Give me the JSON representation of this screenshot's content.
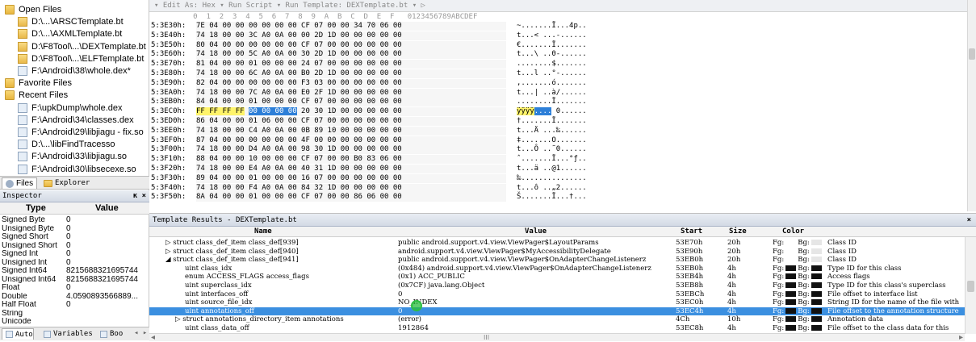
{
  "file_tree": {
    "items": [
      {
        "label": "Open Files",
        "icon": "folder-icon",
        "kind": "folder",
        "level": 0
      },
      {
        "label": "D:\\...\\ARSCTemplate.bt",
        "icon": "template-file-icon",
        "kind": "dex",
        "level": 1
      },
      {
        "label": "D:\\...\\AXMLTemplate.bt",
        "icon": "template-file-icon",
        "kind": "dex",
        "level": 1
      },
      {
        "label": "D:\\F8Tool\\...\\DEXTemplate.bt",
        "icon": "template-file-icon",
        "kind": "dex",
        "level": 1
      },
      {
        "label": "D:\\F8Tool\\...\\ELFTemplate.bt",
        "icon": "template-file-icon",
        "kind": "dex",
        "level": 1
      },
      {
        "label": "F:\\Android\\38\\whole.dex*",
        "icon": "document-icon",
        "kind": "doc",
        "level": 1
      },
      {
        "label": "Favorite Files",
        "icon": "folder-icon",
        "kind": "folder",
        "level": 0
      },
      {
        "label": "Recent Files",
        "icon": "folder-icon",
        "kind": "folder",
        "level": 0
      },
      {
        "label": "F:\\upkDump\\whole.dex",
        "icon": "document-icon",
        "kind": "doc",
        "level": 1
      },
      {
        "label": "F:\\Android\\34\\classes.dex",
        "icon": "document-icon",
        "kind": "doc",
        "level": 1
      },
      {
        "label": "F:\\Android\\29\\libjiagu - fix.so",
        "icon": "document-icon",
        "kind": "doc",
        "level": 1
      },
      {
        "label": "D:\\...\\libFindTracesso",
        "icon": "document-icon",
        "kind": "doc",
        "level": 1
      },
      {
        "label": "F:\\Android\\33\\libjiagu.so",
        "icon": "document-icon",
        "kind": "doc",
        "level": 1
      },
      {
        "label": "F:\\Android\\30\\libsecexe.so",
        "icon": "document-icon",
        "kind": "doc",
        "level": 1
      }
    ],
    "tabs": [
      {
        "label": "Files"
      },
      {
        "label": "Explorer"
      }
    ]
  },
  "inspector": {
    "title": "Inspector",
    "pin": "ĸ ×",
    "col_type": "Type",
    "col_value": "Value",
    "rows": [
      {
        "type": "Signed Byte",
        "value": "0"
      },
      {
        "type": "Unsigned Byte",
        "value": "0"
      },
      {
        "type": "Signed Short",
        "value": "0"
      },
      {
        "type": "Unsigned Short",
        "value": "0"
      },
      {
        "type": "Signed Int",
        "value": "0"
      },
      {
        "type": "Unsigned Int",
        "value": "0"
      },
      {
        "type": "Signed Int64",
        "value": "8215688321695744"
      },
      {
        "type": "Unsigned Int64",
        "value": "8215688321695744"
      },
      {
        "type": "Float",
        "value": "0"
      },
      {
        "type": "Double",
        "value": "4.0590893566889..."
      },
      {
        "type": "Half Float",
        "value": "0"
      },
      {
        "type": "String",
        "value": ""
      },
      {
        "type": "Unicode",
        "value": ""
      }
    ],
    "tabs": [
      {
        "label": "Auto"
      },
      {
        "label": "Variables"
      },
      {
        "label": "Boo"
      }
    ]
  },
  "hex_editor": {
    "toolbar": "▾  Edit As: Hex ▾   Run Script ▾   Run Template: DEXTemplate.bt ▾  ▷",
    "column_header": "          0  1  2  3  4  5  6  7  8  9  A  B  C  D  E  F   0123456789ABCDEF",
    "rows": [
      {
        "addr": "5:3E30h:",
        "bytes": "7E 04 00 00 00 00 00 00 CF 07 00 00 34 70 06 00",
        "ascii": "~.......Ï...4p.."
      },
      {
        "addr": "5:3E40h:",
        "bytes": "74 18 00 00 3C A0 0A 00 00 2D 1D 00 00 00 00 00",
        "ascii": "t...< ...-......"
      },
      {
        "addr": "5:3E50h:",
        "bytes": "80 04 00 00 00 00 00 00 CF 07 00 00 00 00 00 00",
        "ascii": "€.......Ï......."
      },
      {
        "addr": "5:3E60h:",
        "bytes": "74 18 00 00 5C A0 0A 00 30 2D 1D 00 00 00 00 00",
        "ascii": "t...\\ ..0-......"
      },
      {
        "addr": "5:3E70h:",
        "bytes": "81 04 00 00 01 00 00 00 24 07 00 00 00 00 00 00",
        "ascii": "........$......."
      },
      {
        "addr": "5:3E80h:",
        "bytes": "74 18 00 00 6C A0 0A 00 B0 2D 1D 00 00 00 00 00",
        "ascii": "t...l ..°-......"
      },
      {
        "addr": "5:3E90h:",
        "bytes": "82 04 00 00 00 00 00 00 F3 03 00 00 00 00 00 00",
        "ascii": ",.......ó......."
      },
      {
        "addr": "5:3EA0h:",
        "bytes": "74 18 00 00 7C A0 0A 00 E0 2F 1D 00 00 00 00 00",
        "ascii": "t...| ..à/......"
      },
      {
        "addr": "5:3EB0h:",
        "bytes": "84 04 00 00 01 00 00 00 CF 07 00 00 00 00 00 00",
        "ascii": "........Ï......."
      },
      {
        "addr": "5:3EC0h:",
        "bytes": "FF FF FF FF 00 00 00 00 20 30 1D 00 00 00 00 00",
        "ascii": "ÿÿÿÿ.... 0......",
        "hl": true
      },
      {
        "addr": "5:3ED0h:",
        "bytes": "86 04 00 00 01 06 00 00 CF 07 00 00 00 00 00 00",
        "ascii": "†.......Ï......."
      },
      {
        "addr": "5:3EE0h:",
        "bytes": "74 18 00 00 C4 A0 0A 00 0B 89 10 00 00 00 00 00",
        "ascii": "t...Ä ...‰......"
      },
      {
        "addr": "5:3EF0h:",
        "bytes": "87 04 00 00 00 00 00 00 4F 00 00 00 00 00 00 00",
        "ascii": "‡.......O......."
      },
      {
        "addr": "5:3F00h:",
        "bytes": "74 18 00 00 D4 A0 0A 00 98 30 1D 00 00 00 00 00",
        "ascii": "t...Ô ..˜0......"
      },
      {
        "addr": "5:3F10h:",
        "bytes": "88 04 00 00 10 00 00 00 CF 07 00 00 B0 83 06 00",
        "ascii": "ˆ.......Ï...°ƒ.."
      },
      {
        "addr": "5:3F20h:",
        "bytes": "74 18 00 00 E4 A0 0A 00 40 31 1D 00 00 00 00 00",
        "ascii": "t...ä ..@1......"
      },
      {
        "addr": "5:3F30h:",
        "bytes": "89 04 00 00 01 00 00 00 16 07 00 00 00 00 00 00",
        "ascii": "‰..............."
      },
      {
        "addr": "5:3F40h:",
        "bytes": "74 18 00 00 F4 A0 0A 00 84 32 1D 00 00 00 00 00",
        "ascii": "t...ô ..„2......"
      },
      {
        "addr": "5:3F50h:",
        "bytes": "8A 04 00 00 01 00 00 00 CF 07 00 00 86 06 00 00",
        "ascii": "Š.......Ï...†..."
      }
    ]
  },
  "template_results": {
    "title": "Template Results - DEXTemplate.bt",
    "columns": {
      "name": "Name",
      "value": "Value",
      "start": "Start",
      "size": "Size",
      "color": "Color"
    },
    "rows": [
      {
        "name": "▷ struct class_def_item class_def[939]",
        "value": "public android.support.v4.view.ViewPager$LayoutParams",
        "start": "53E70h",
        "size": "20h",
        "fg": "Fg:",
        "bg": "Bg:",
        "fgc": "#ffffff",
        "bgc": "#e6e6e6",
        "comment": "Class ID",
        "indent": 1
      },
      {
        "name": "▷ struct class_def_item class_def[940]",
        "value": "android.support.v4.view.ViewPager$MyAccessibilityDelegate",
        "start": "53E90h",
        "size": "20h",
        "fg": "Fg:",
        "bg": "Bg:",
        "fgc": "#ffffff",
        "bgc": "#e6e6e6",
        "comment": "Class ID",
        "indent": 1
      },
      {
        "name": "◢ struct class_def_item class_def[941]",
        "value": "public android.support.v4.view.ViewPager$OnAdapterChangeListenerz",
        "start": "53EB0h",
        "size": "20h",
        "fg": "Fg:",
        "bg": "Bg:",
        "fgc": "#ffffff",
        "bgc": "#e6e6e6",
        "comment": "Class ID",
        "indent": 1
      },
      {
        "name": "uint class_idx",
        "value": "(0x484) android.support.v4.view.ViewPager$OnAdapterChangeListenerz",
        "start": "53EB0h",
        "size": "4h",
        "fg": "Fg:",
        "bg": "Bg:",
        "fgc": "#111111",
        "bgc": "#111111",
        "comment": "Type ID for this class",
        "indent": 3
      },
      {
        "name": "enum ACCESS_FLAGS access_flags",
        "value": "(0x1) ACC_PUBLIC",
        "start": "53EB4h",
        "size": "4h",
        "fg": "Fg:",
        "bg": "Bg:",
        "fgc": "#111111",
        "bgc": "#111111",
        "comment": "Access flags",
        "indent": 3
      },
      {
        "name": "uint superclass_idx",
        "value": "(0x7CF) java.lang.Object",
        "start": "53EB8h",
        "size": "4h",
        "fg": "Fg:",
        "bg": "Bg:",
        "fgc": "#111111",
        "bgc": "#111111",
        "comment": "Type ID for this class's superclass",
        "indent": 3
      },
      {
        "name": "uint interfaces_off",
        "value": "0",
        "start": "53EBCh",
        "size": "4h",
        "fg": "Fg:",
        "bg": "Bg:",
        "fgc": "#111111",
        "bgc": "#111111",
        "comment": "File offset to interface list",
        "indent": 3
      },
      {
        "name": "uint source_file_idx",
        "value": "NO_INDEX",
        "start": "53EC0h",
        "size": "4h",
        "fg": "Fg:",
        "bg": "Bg:",
        "fgc": "#111111",
        "bgc": "#111111",
        "comment": "String ID for the name of the file with",
        "indent": 3
      },
      {
        "name": "uint annotations_off",
        "value": "0",
        "start": "53EC4h",
        "size": "4h",
        "fg": "Fg:",
        "bg": "Bg:",
        "fgc": "#111111",
        "bgc": "#111111",
        "comment": "File offset to the annotation structure",
        "indent": 3,
        "selected": true
      },
      {
        "name": "▷ struct annotations_directory_item annotations",
        "value": "(error)",
        "start": "4Ch",
        "size": "10h",
        "fg": "Fg:",
        "bg": "Bg:",
        "fgc": "#111111",
        "bgc": "#111111",
        "comment": "Annotation data",
        "indent": 2
      },
      {
        "name": "uint class_data_off",
        "value": "1912864",
        "start": "53EC8h",
        "size": "4h",
        "fg": "Fg:",
        "bg": "Bg:",
        "fgc": "#111111",
        "bgc": "#111111",
        "comment": "File offset to the class data for this",
        "indent": 3
      }
    ],
    "scroll_label": "III"
  }
}
